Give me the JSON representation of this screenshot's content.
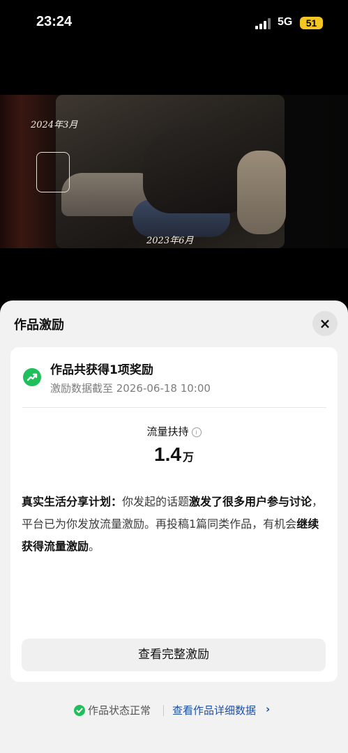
{
  "status_bar": {
    "time": "23:24",
    "network": "5G",
    "battery": "51"
  },
  "photo": {
    "caption_top": "2024年3月",
    "caption_bottom": "2023年6月"
  },
  "sheet": {
    "title": "作品激励",
    "close_icon": "×",
    "card": {
      "headline": "作品共获得1项奖励",
      "subtitle": "激励数据截至 2026-06-18 10:00",
      "metric": {
        "label": "流量扶持",
        "value": "1.4",
        "unit": "万"
      },
      "description": {
        "part1": "真实生活分享计划：",
        "part2": "你发起的话题",
        "part3": "激发了很多用户参与讨论",
        "part4": "，平台已为你发放流量激励。再投稿1篇同类作品，有机会",
        "part5": "继续获得流量激励",
        "part6": "。"
      },
      "button": "查看完整激励"
    },
    "footer": {
      "status": "作品状态正常",
      "link": "查看作品详细数据",
      "chevron": "›"
    }
  },
  "colors": {
    "accent_green": "#1fbf5b",
    "link_blue": "#1f4fa6",
    "battery_yellow": "#f3c621"
  }
}
